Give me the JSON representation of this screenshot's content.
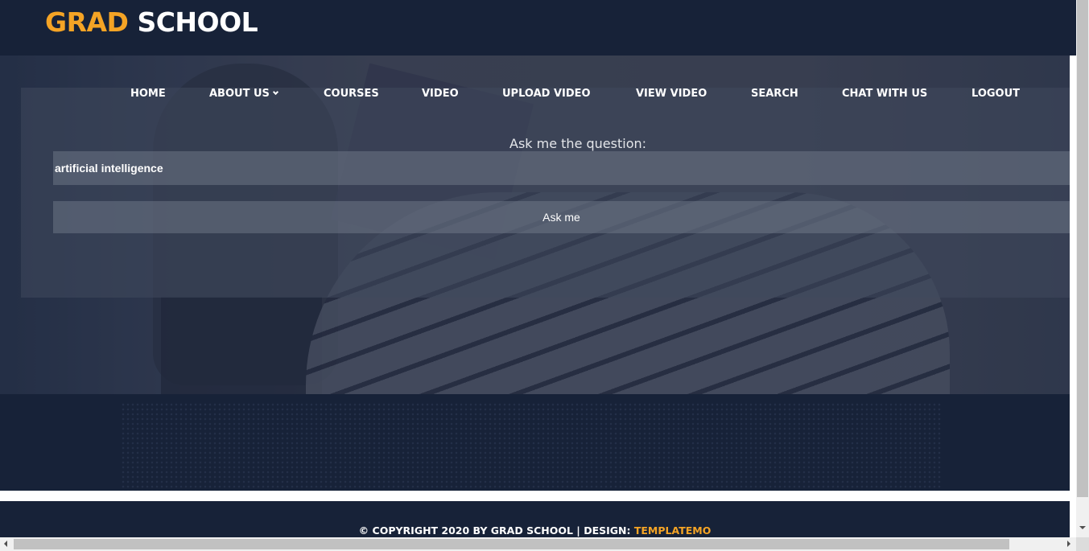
{
  "header": {
    "logo_accent": "GRAD",
    "logo_rest": "SCHOOL"
  },
  "nav": {
    "items": [
      {
        "label": "HOME"
      },
      {
        "label": "ABOUT US",
        "icon": "chevron-down-icon"
      },
      {
        "label": "COURSES"
      },
      {
        "label": "VIDEO"
      },
      {
        "label": "UPLOAD VIDEO"
      },
      {
        "label": "VIEW VIDEO"
      },
      {
        "label": "SEARCH"
      },
      {
        "label": "CHAT WITH US"
      },
      {
        "label": "LOGOUT"
      }
    ]
  },
  "question": {
    "label": "Ask me the question:",
    "input_value": "artificial intelligence",
    "button_label": "Ask me"
  },
  "footer": {
    "text": "© COPYRIGHT 2020 BY GRAD SCHOOL | DESIGN: ",
    "link": "TEMPLATEMO"
  },
  "colors": {
    "navy": "#172238",
    "accent": "#f5a425"
  }
}
